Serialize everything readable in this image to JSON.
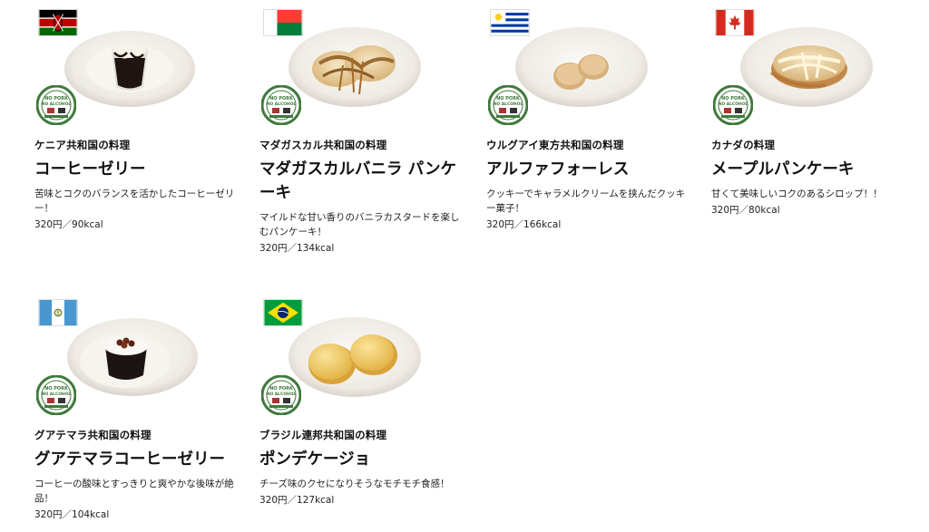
{
  "items": [
    {
      "country": "ケニア共和国の料理",
      "name": "コーヒーゼリー",
      "desc": "苦味とコクのバランスを活かしたコーヒーゼリー！",
      "price": "320円／90kcal",
      "flag": "kenya-flag-icon",
      "food": "coffee-jelly"
    },
    {
      "country": "マダガスカル共和国の料理",
      "name": "マダガスカルバニラ パンケーキ",
      "desc": "マイルドな甘い香りのバニラカスタードを楽しむパンケーキ！",
      "price": "320円／134kcal",
      "flag": "madagascar-flag-icon",
      "food": "vanilla-pancake"
    },
    {
      "country": "ウルグアイ東方共和国の料理",
      "name": "アルファフォーレス",
      "desc": "クッキーでキャラメルクリームを挟んだクッキー菓子！",
      "price": "320円／166kcal",
      "flag": "uruguay-flag-icon",
      "food": "alfajores"
    },
    {
      "country": "カナダの料理",
      "name": "メープルパンケーキ",
      "desc": "甘くて美味しいコクのあるシロップ！！",
      "price": "320円／80kcal",
      "flag": "canada-flag-icon",
      "food": "maple-pancake"
    },
    {
      "country": "グアテマラ共和国の料理",
      "name": "グアテマラコーヒーゼリー",
      "desc": "コーヒーの酸味とすっきりと爽やかな後味が絶品！",
      "price": "320円／104kcal",
      "flag": "guatemala-flag-icon",
      "food": "guatemala-coffee-jelly"
    },
    {
      "country": "ブラジル連邦共和国の料理",
      "name": "ポンデケージョ",
      "desc": "チーズ味のクセになりそうなモチモチ食感！",
      "price": "320円／127kcal",
      "flag": "brazil-flag-icon",
      "food": "pao-de-queijo"
    }
  ],
  "badge": {
    "line1": "NO PORK",
    "line2": "NO ALCOHOL"
  },
  "colors": {
    "badge_green": "#3f7a3c",
    "plate": "#f2efe9"
  }
}
